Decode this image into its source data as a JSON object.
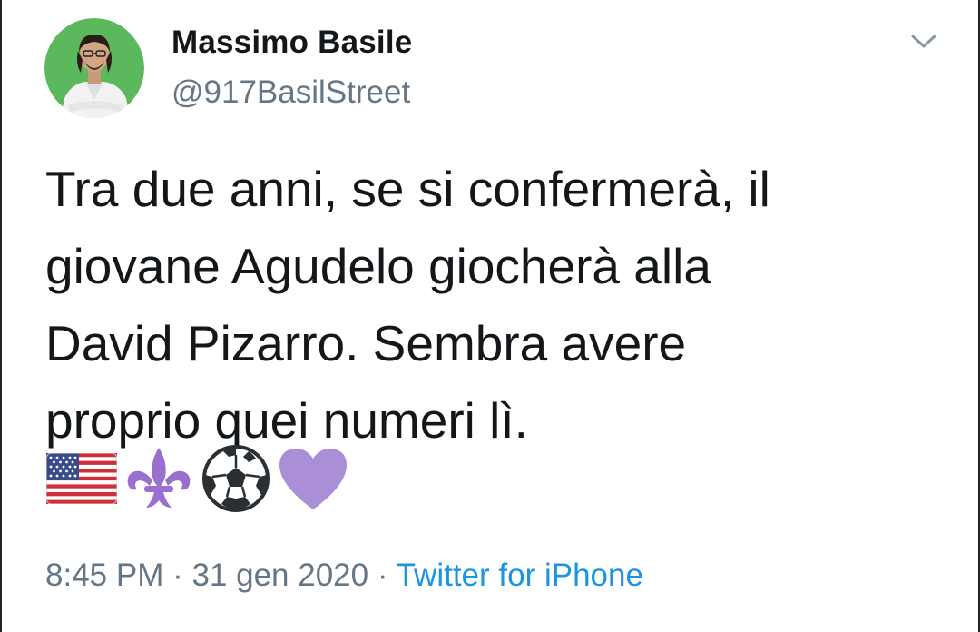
{
  "tweet": {
    "author": {
      "display_name": "Massimo Basile",
      "handle": "@917BasilStreet",
      "avatar_icon": "profile-photo"
    },
    "menu_icon": "chevron-down-icon",
    "text_lines": [
      "Tra due anni, se si confermerà, il",
      "giovane Agudelo giocherà alla",
      "David Pizarro. Sembra avere",
      "proprio quei numeri lì."
    ],
    "emojis": [
      "us-flag-emoji",
      "fleur-de-lis-emoji",
      "soccer-ball-emoji",
      "purple-heart-emoji"
    ],
    "meta": {
      "time": "8:45 PM",
      "separator": " · ",
      "date": "31 gen 2020",
      "separator2": " · ",
      "source": "Twitter for iPhone"
    },
    "colors": {
      "avatar_bg": "#5cb85c",
      "link": "#1b95e0",
      "secondary_text": "#657786",
      "primary_text": "#14171a",
      "purple": "#9b6fcf"
    }
  }
}
